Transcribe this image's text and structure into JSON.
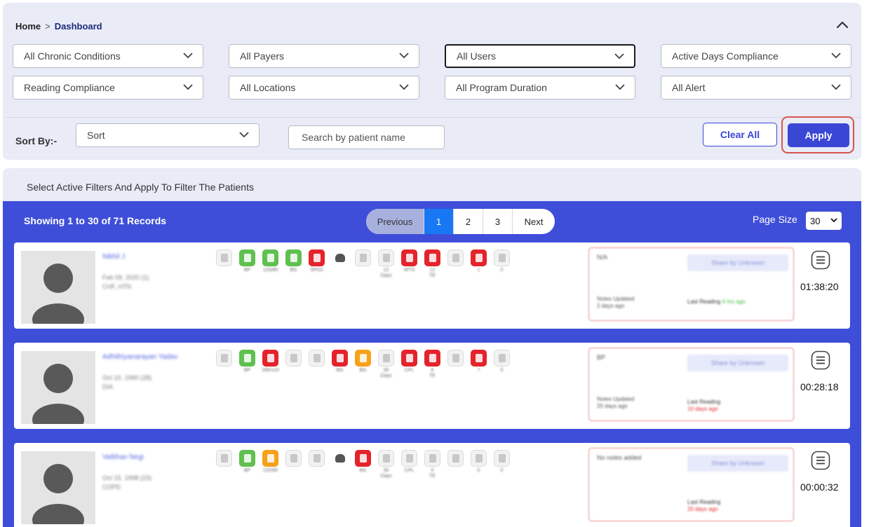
{
  "breadcrumb": {
    "home": "Home",
    "separator": ">",
    "current": "Dashboard"
  },
  "filters": [
    {
      "label": "All Chronic Conditions"
    },
    {
      "label": "All Payers"
    },
    {
      "label": "All Users"
    },
    {
      "label": "Active Days Compliance"
    },
    {
      "label": "Reading Compliance"
    },
    {
      "label": "All Locations"
    },
    {
      "label": "All Program Duration"
    },
    {
      "label": "All Alert"
    }
  ],
  "sort": {
    "label": "Sort By:-",
    "value": "Sort"
  },
  "search": {
    "placeholder": "Search by patient name"
  },
  "buttons": {
    "clear_all": "Clear All",
    "apply": "Apply"
  },
  "results": {
    "hint": "Select Active Filters And Apply To Filter The Patients",
    "records": "Showing 1 to 30 of 71 Records",
    "pagination": {
      "previous": "Previous",
      "pages": [
        "1",
        "2",
        "3"
      ],
      "current": "1",
      "next": "Next"
    },
    "page_size_label": "Page Size",
    "page_size_value": "30"
  },
  "patients": [
    {
      "name": "Nikhil J",
      "dob": "Feb 09, 2020 (1)",
      "condition": "CHF, HTN",
      "notes_title": "N/A",
      "notes_button": "Share by Unknown",
      "notes_updated": "Notes Updated",
      "notes_updated_ago": "2 days ago",
      "last_reading_label": "Last Reading",
      "last_reading": "4 hrs ago",
      "timer": "01:38:20",
      "icons": [
        {
          "kind": "w",
          "cap": ""
        },
        {
          "kind": "g",
          "cap": "BP"
        },
        {
          "kind": "g",
          "cap": "120/80"
        },
        {
          "kind": "g",
          "cap": "BG"
        },
        {
          "kind": "r",
          "cap": "SPO2"
        },
        {
          "kind": "d",
          "cap": ""
        },
        {
          "kind": "w",
          "cap": ""
        },
        {
          "kind": "w",
          "cap": "12\nDays"
        },
        {
          "kind": "r",
          "cap": "WTS"
        },
        {
          "kind": "r",
          "cap": "12\nTE"
        },
        {
          "kind": "w",
          "cap": ""
        },
        {
          "kind": "r",
          "cap": "1"
        },
        {
          "kind": "w",
          "cap": "0"
        }
      ]
    },
    {
      "name": "Adhithiyanarayan Yadav",
      "dob": "Oct 10, 1990 (28)",
      "condition": "DIA",
      "notes_title": "BP",
      "notes_button": "Share by Unknown",
      "notes_updated": "Notes Updated",
      "notes_updated_ago": "20 days ago",
      "last_reading_label": "Last Reading",
      "last_reading": "10 days ago",
      "timer": "00:28:18",
      "icons": [
        {
          "kind": "w",
          "cap": ""
        },
        {
          "kind": "g",
          "cap": "BP"
        },
        {
          "kind": "r",
          "cap": "180/110"
        },
        {
          "kind": "w",
          "cap": ""
        },
        {
          "kind": "w",
          "cap": ""
        },
        {
          "kind": "r",
          "cap": "BG"
        },
        {
          "kind": "o",
          "cap": "BG"
        },
        {
          "kind": "w",
          "cap": "30\nDays"
        },
        {
          "kind": "r",
          "cap": "CPL"
        },
        {
          "kind": "r",
          "cap": "8\nTE"
        },
        {
          "kind": "w",
          "cap": ""
        },
        {
          "kind": "r",
          "cap": "7"
        },
        {
          "kind": "w",
          "cap": "0"
        }
      ]
    },
    {
      "name": "Vaibhav Negi",
      "dob": "Oct 15, 1998 (23)",
      "condition": "COPD",
      "notes_title": "No notes added",
      "notes_button": "Share by Unknown",
      "notes_updated": "",
      "notes_updated_ago": "",
      "last_reading_label": "Last Reading",
      "last_reading": "20 days ago",
      "timer": "00:00:32",
      "icons": [
        {
          "kind": "w",
          "cap": ""
        },
        {
          "kind": "g",
          "cap": "BP"
        },
        {
          "kind": "o",
          "cap": "132/90"
        },
        {
          "kind": "w",
          "cap": ""
        },
        {
          "kind": "w",
          "cap": ""
        },
        {
          "kind": "d",
          "cap": ""
        },
        {
          "kind": "r",
          "cap": "BG"
        },
        {
          "kind": "w",
          "cap": "30\nDays"
        },
        {
          "kind": "w",
          "cap": "CPL"
        },
        {
          "kind": "w",
          "cap": "0\nTE"
        },
        {
          "kind": "w",
          "cap": ""
        },
        {
          "kind": "w",
          "cap": "0"
        },
        {
          "kind": "w",
          "cap": "0"
        }
      ]
    }
  ]
}
